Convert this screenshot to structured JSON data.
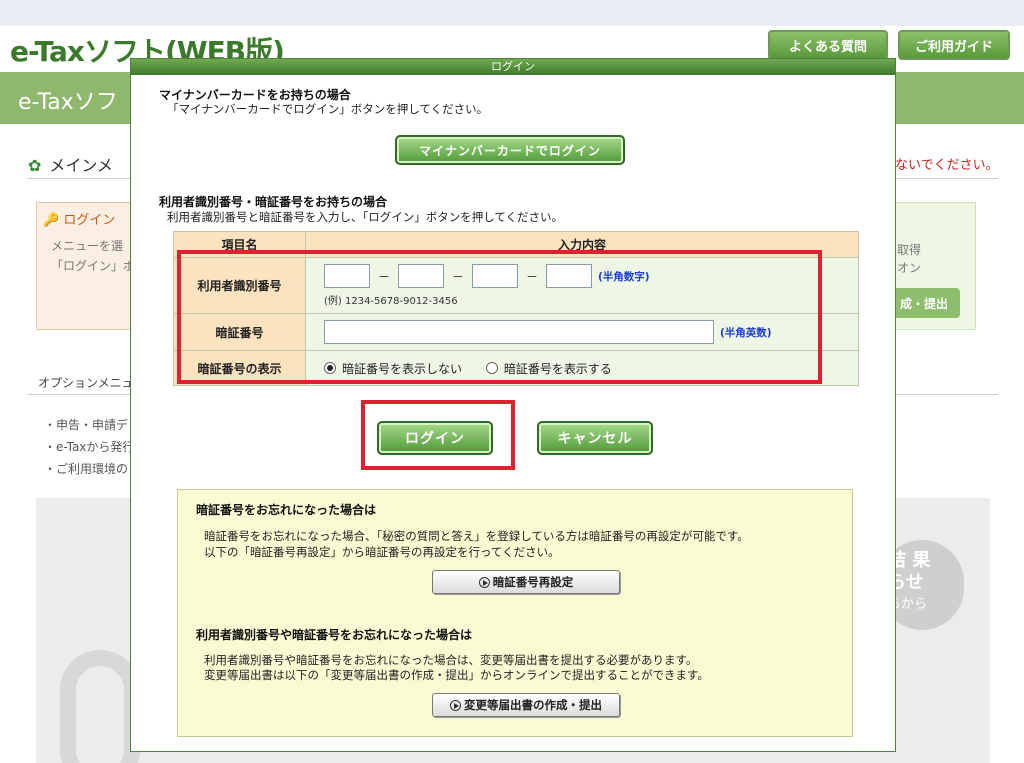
{
  "background": {
    "logo": "e-Taxソフト(WEB版)",
    "nav": {
      "faq": "よくある質問",
      "guide": "ご利用ガイド"
    },
    "band_title": "e-Taxソフ",
    "menu_title": "メインメ",
    "warning": "ないでください。",
    "login_box": {
      "title": "ログイン",
      "line1": "メニューを選",
      "line2": "「ログイン」ボ"
    },
    "right_box": {
      "line1": "取得",
      "line2": "オン",
      "button": "成・提出"
    },
    "option_menu": "オプションメニュ",
    "list": [
      "・申告・申請デ",
      "・e-Taxから発行",
      "・ご利用環境の"
    ],
    "result": {
      "line1": "結 果",
      "line2": "らせ",
      "line3": "らから"
    }
  },
  "dialog": {
    "title": "ログイン",
    "mynumber": {
      "heading": "マイナンバーカードをお持ちの場合",
      "description": "「マイナンバーカードでログイン」ボタンを押してください。",
      "button": "マイナンバーカードでログイン"
    },
    "id_section": {
      "heading": "利用者識別番号・暗証番号をお持ちの場合",
      "description": "利用者識別番号と暗証番号を入力し、「ログイン」ボタンを押してください。"
    },
    "table": {
      "col_item": "項目名",
      "col_input": "入力内容",
      "user_id": {
        "label": "利用者識別番号",
        "separator": "－",
        "hint": "(半角数字)",
        "example": "(例) 1234-5678-9012-3456"
      },
      "password": {
        "label": "暗証番号",
        "hint": "(半角英数)"
      },
      "display": {
        "label": "暗証番号の表示",
        "hide": "暗証番号を表示しない",
        "show": "暗証番号を表示する"
      }
    },
    "buttons": {
      "login": "ログイン",
      "cancel": "キャンセル"
    },
    "forgot_password": {
      "heading": "暗証番号をお忘れになった場合は",
      "line1": "暗証番号をお忘れになった場合、「秘密の質問と答え」を登録している方は暗証番号の再設定が可能です。",
      "line2": "以下の「暗証番号再設定」から暗証番号の再設定を行ってください。",
      "button": "暗証番号再設定"
    },
    "forgot_both": {
      "heading": "利用者識別番号や暗証番号をお忘れになった場合は",
      "line1": "利用者識別番号や暗証番号をお忘れになった場合は、変更等届出書を提出する必要があります。",
      "line2": "変更等届出書は以下の「変更等届出書の作成・提出」からオンラインで提出することができます。",
      "button": "変更等届出書の作成・提出"
    }
  },
  "colors": {
    "accent": "#4f9a37",
    "highlight": "#e0202f",
    "warning": "#cc2222"
  },
  "icons": [
    "leaf-icon",
    "key-icon",
    "play-circle-icon"
  ]
}
